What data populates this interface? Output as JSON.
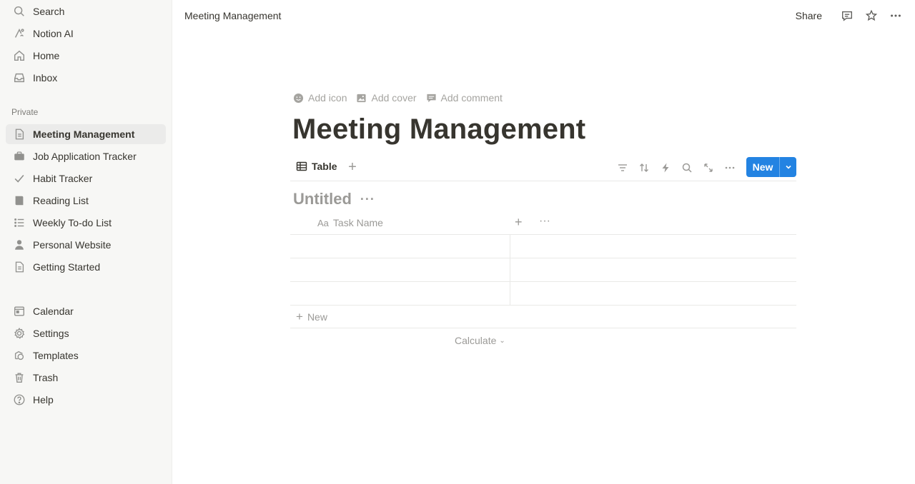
{
  "sidebar": {
    "top_items": [
      {
        "label": "Search",
        "icon": "search-icon"
      },
      {
        "label": "Notion AI",
        "icon": "notion-ai-icon"
      },
      {
        "label": "Home",
        "icon": "home-icon"
      },
      {
        "label": "Inbox",
        "icon": "inbox-icon"
      }
    ],
    "section_label": "Private",
    "pages": [
      {
        "label": "Meeting Management",
        "icon": "page-icon",
        "active": true
      },
      {
        "label": "Job Application Tracker",
        "icon": "briefcase-icon"
      },
      {
        "label": "Habit Tracker",
        "icon": "checkmark-icon"
      },
      {
        "label": "Reading List",
        "icon": "book-icon"
      },
      {
        "label": "Weekly To-do List",
        "icon": "bullet-list-icon"
      },
      {
        "label": "Personal Website",
        "icon": "person-icon"
      },
      {
        "label": "Getting Started",
        "icon": "page-icon"
      }
    ],
    "bottom_items": [
      {
        "label": "Calendar",
        "icon": "calendar-icon"
      },
      {
        "label": "Settings",
        "icon": "gear-icon"
      },
      {
        "label": "Templates",
        "icon": "templates-icon"
      },
      {
        "label": "Trash",
        "icon": "trash-icon"
      },
      {
        "label": "Help",
        "icon": "help-icon"
      }
    ]
  },
  "topbar": {
    "breadcrumb": "Meeting Management",
    "share_label": "Share"
  },
  "page": {
    "add_icon": "Add icon",
    "add_cover": "Add cover",
    "add_comment": "Add comment",
    "title": "Meeting Management"
  },
  "database": {
    "view_label": "Table",
    "new_button": "New",
    "title": "Untitled",
    "column_name": "Task Name",
    "column_prefix": "Aa",
    "new_row_label": "New",
    "calculate_label": "Calculate"
  },
  "colors": {
    "accent": "#2383e2",
    "sidebar_bg": "#f7f7f5",
    "text": "#37352f",
    "muted": "#9b9a97"
  }
}
